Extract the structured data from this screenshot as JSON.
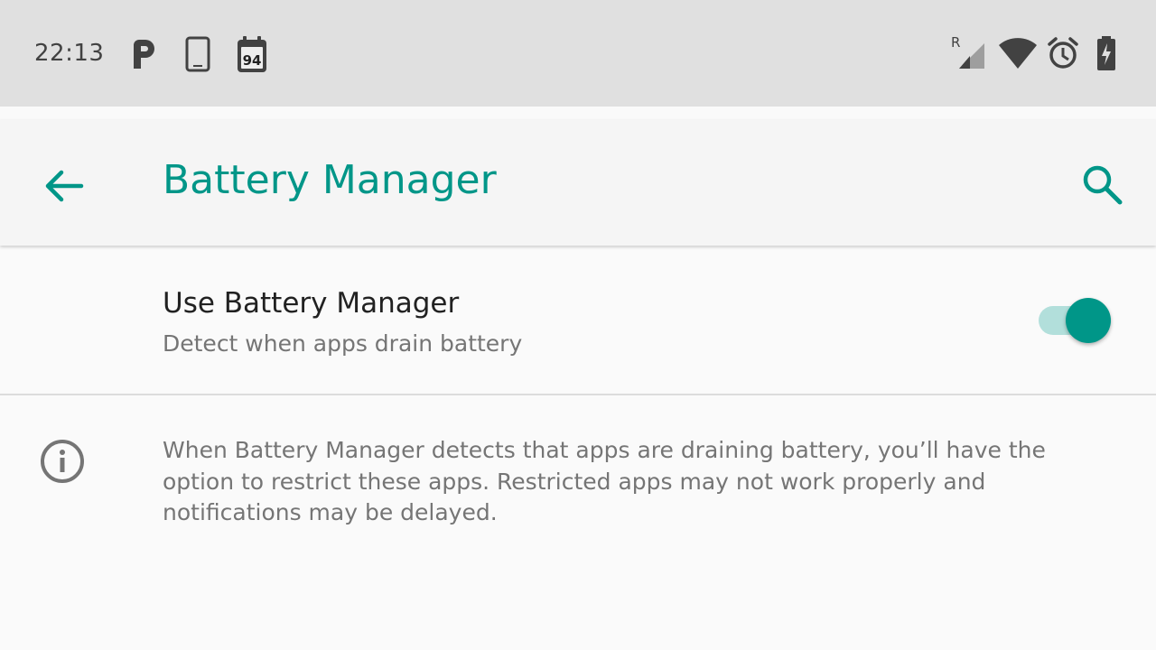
{
  "status_bar": {
    "time": "22:13",
    "left_icons": [
      "parking-icon",
      "tablet-icon",
      "calendar-icon"
    ],
    "calendar_day": "94",
    "roaming_label": "R",
    "right_icons": [
      "signal-roaming-icon",
      "wifi-icon",
      "alarm-icon",
      "battery-charging-icon"
    ]
  },
  "app_bar": {
    "title": "Battery Manager",
    "back_icon": "arrow-back-icon",
    "search_icon": "search-icon"
  },
  "preference": {
    "title": "Use Battery Manager",
    "summary": "Detect when apps drain battery",
    "enabled": true
  },
  "info": {
    "icon": "info-icon",
    "text": "When Battery Manager detects that apps are draining battery, you’ll have the option to restrict these apps. Restricted apps may not work properly and notifications may be delayed."
  },
  "colors": {
    "accent": "#009688",
    "track_on": "#b2dfdb",
    "status_bar_bg": "#e0e0e0",
    "app_bar_bg": "#f5f5f5",
    "page_bg": "#fafafa"
  }
}
